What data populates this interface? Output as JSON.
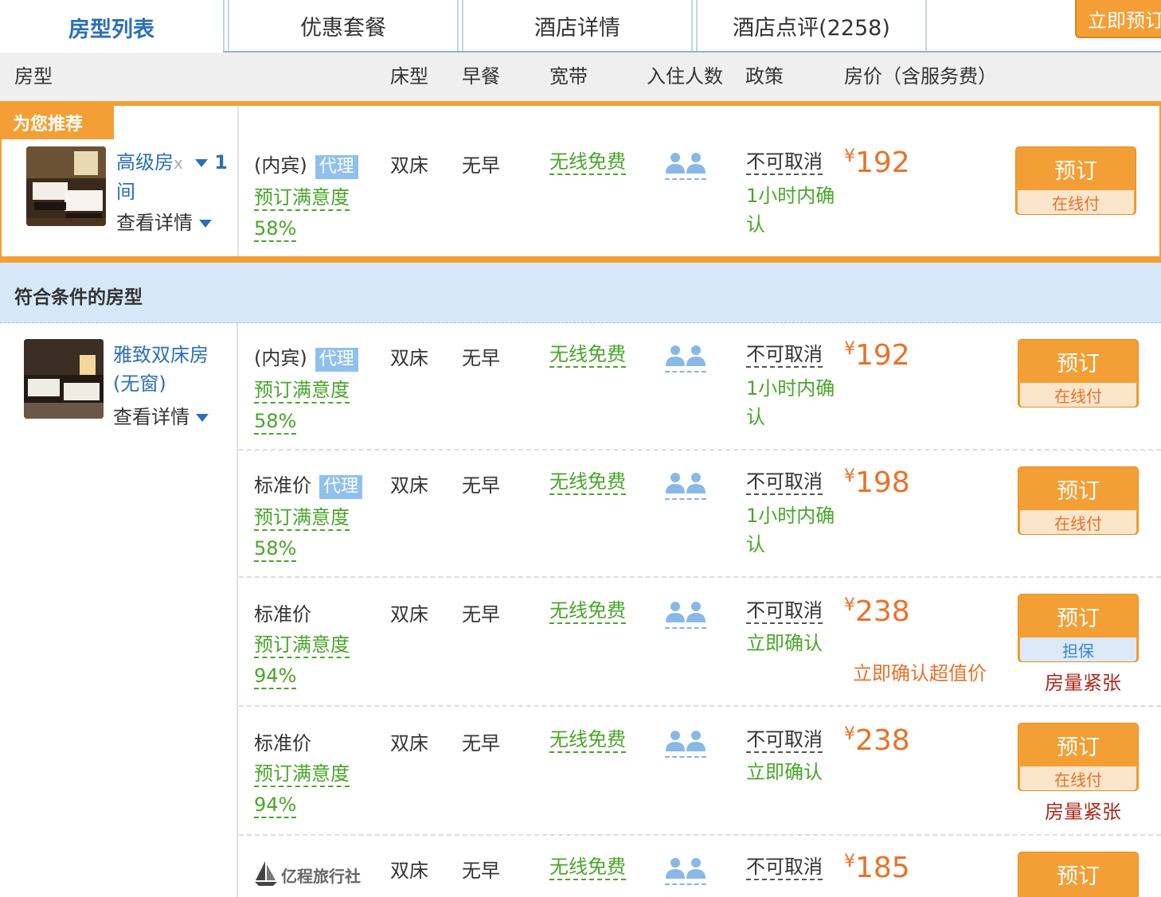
{
  "tabs": [
    {
      "label": "房型列表"
    },
    {
      "label": "优惠套餐"
    },
    {
      "label": "酒店详情"
    },
    {
      "label": "酒店点评(2258)"
    }
  ],
  "book_now_top": "立即预订",
  "header": {
    "room_type": "房型",
    "bed": "床型",
    "breakfast": "早餐",
    "broadband": "宽带",
    "guests": "入住人数",
    "policy": "政策",
    "price": "房价（含服务费）"
  },
  "recommended": {
    "badge": "为您推荐",
    "room_name": "高级房",
    "remove_mark": "x",
    "qty": "1",
    "qty_unit": "间",
    "detail_link": "查看详情",
    "offer": {
      "plan": "(内宾)",
      "agent": "代理",
      "sat_label": "预订满意度",
      "sat_value": "58%",
      "bed": "双床",
      "meal": "无早",
      "wifi": "无线免费",
      "policy": "不可取消",
      "confirm": "1小时内确认",
      "currency": "¥",
      "price": "192",
      "book": "预订",
      "pay": "在线付"
    }
  },
  "section_title": "符合条件的房型",
  "room2": {
    "name": "雅致双床房(无窗)",
    "detail_link": "查看详情",
    "offers": [
      {
        "plan": "(内宾)",
        "agent": "代理",
        "sat_label": "预订满意度",
        "sat_value": "58%",
        "bed": "双床",
        "meal": "无早",
        "wifi": "无线免费",
        "policy": "不可取消",
        "confirm": "1小时内确认",
        "currency": "¥",
        "price": "192",
        "book": "预订",
        "pay": "在线付",
        "note": "",
        "scarce": ""
      },
      {
        "plan": "标准价",
        "agent": "代理",
        "sat_label": "预订满意度",
        "sat_value": "58%",
        "bed": "双床",
        "meal": "无早",
        "wifi": "无线免费",
        "policy": "不可取消",
        "confirm": "1小时内确认",
        "currency": "¥",
        "price": "198",
        "book": "预订",
        "pay": "在线付",
        "note": "",
        "scarce": ""
      },
      {
        "plan": "标准价",
        "agent": "",
        "sat_label": "预订满意度",
        "sat_value": "94%",
        "bed": "双床",
        "meal": "无早",
        "wifi": "无线免费",
        "policy": "不可取消",
        "confirm": "立即确认",
        "currency": "¥",
        "price": "238",
        "book": "预订",
        "pay": "担保",
        "note": "立即确认超值价",
        "scarce": "房量紧张"
      },
      {
        "plan": "标准价",
        "agent": "",
        "sat_label": "预订满意度",
        "sat_value": "94%",
        "bed": "双床",
        "meal": "无早",
        "wifi": "无线免费",
        "policy": "不可取消",
        "confirm": "立即确认",
        "currency": "¥",
        "price": "238",
        "book": "预订",
        "pay": "在线付",
        "note": "",
        "scarce": "房量紧张"
      },
      {
        "plan": "亿程旅行社",
        "bed": "双床",
        "meal": "无早",
        "wifi": "无线免费",
        "policy": "不可取消",
        "currency": "¥",
        "price": "185",
        "book": "预订"
      }
    ]
  },
  "icons": {
    "guests": "two-people-icon",
    "dropdown": "triangle-down-icon",
    "agency_logo": "sailboat-logo-icon"
  },
  "colors": {
    "accent_orange": "#f39f35",
    "price_orange": "#e8722a",
    "link_blue": "#2c6fb5",
    "green": "#4aa529",
    "section_blue": "#d6e8f8"
  }
}
